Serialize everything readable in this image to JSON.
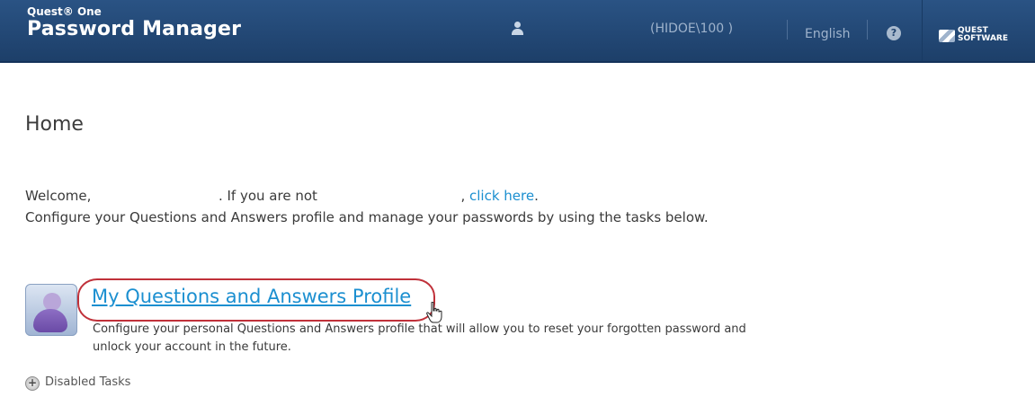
{
  "header": {
    "brand_top": "Quest® One",
    "brand_main": "Password Manager",
    "user_domain": "(HIDOE\\100          )",
    "language": "English",
    "help_symbol": "?",
    "logo_line1": "QUEST",
    "logo_line2": "SOFTWARE"
  },
  "main": {
    "title": "Home",
    "welcome_prefix": "Welcome,",
    "welcome_mid": ". If you are not",
    "welcome_comma": ",",
    "welcome_link": "click here",
    "welcome_period": ".",
    "instructions": "Configure your Questions and Answers profile and manage your passwords by using the tasks below."
  },
  "task": {
    "title": "My Questions and Answers Profile",
    "description": "Configure your personal Questions and Answers profile that will allow you to reset your forgotten password and unlock your account in the future."
  },
  "disabled_tasks": {
    "label": "Disabled Tasks",
    "icon_symbol": "+"
  },
  "icons": {
    "user": "user-icon",
    "help": "help-icon",
    "task": "person-profile-icon",
    "expand": "plus-circle-icon",
    "cursor": "hand-pointer-icon"
  },
  "colors": {
    "header_bg": "#23497a",
    "link": "#1b8fd0",
    "highlight_ring": "#c0313a"
  }
}
